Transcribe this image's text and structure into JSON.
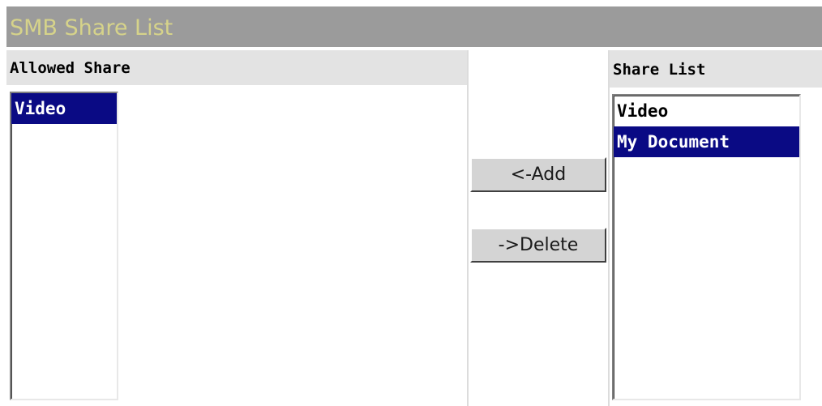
{
  "window": {
    "title": "SMB Share List"
  },
  "allowed_share": {
    "header": "Allowed Share",
    "items": [
      {
        "label": "Video",
        "selected": true
      }
    ]
  },
  "share_list": {
    "header": "Share List",
    "items": [
      {
        "label": "Video",
        "selected": false
      },
      {
        "label": "My Document",
        "selected": true
      }
    ]
  },
  "actions": {
    "add_label": "<-Add",
    "delete_label": "->Delete"
  },
  "colors": {
    "title_bar_bg": "#9b9b9b",
    "title_text": "#d6d38a",
    "header_bg": "#e3e3e3",
    "selection_bg": "#0a0a84",
    "selection_text": "#ffffff",
    "button_face": "#d4d4d4"
  }
}
